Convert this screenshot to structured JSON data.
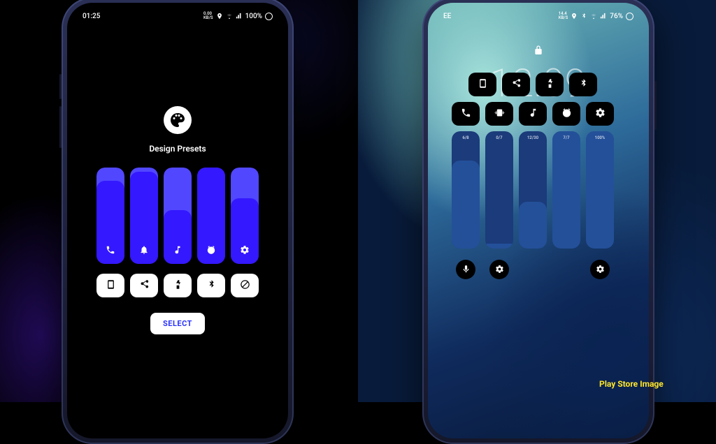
{
  "caption": "Play Store Image",
  "left_phone": {
    "status": {
      "time": "01:25",
      "battery": "100%"
    },
    "heading": "Design Presets",
    "sliders": [
      {
        "icon": "phone-icon",
        "fill_pct": 86
      },
      {
        "icon": "bell-icon",
        "fill_pct": 96
      },
      {
        "icon": "music-icon",
        "fill_pct": 56
      },
      {
        "icon": "alarm-icon",
        "fill_pct": 100
      },
      {
        "icon": "gear-icon",
        "fill_pct": 68
      }
    ],
    "buttons": [
      {
        "icon": "screen-icon"
      },
      {
        "icon": "share-icon"
      },
      {
        "icon": "flashlight-icon"
      },
      {
        "icon": "bluetooth-icon"
      },
      {
        "icon": "block-icon"
      }
    ],
    "select_label": "SELECT"
  },
  "right_phone": {
    "status": {
      "carrier": "EE",
      "battery": "76%"
    },
    "clock": "12:09",
    "row1": [
      {
        "icon": "screen-icon"
      },
      {
        "icon": "share-icon"
      },
      {
        "icon": "flashlight-icon"
      },
      {
        "icon": "bluetooth-icon"
      }
    ],
    "row2": [
      {
        "icon": "phone-icon"
      },
      {
        "icon": "vibrate-icon"
      },
      {
        "icon": "music-icon"
      },
      {
        "icon": "alarm-icon"
      },
      {
        "icon": "gear-icon"
      }
    ],
    "sliders": [
      {
        "label": "6/8",
        "fill_pct": 75
      },
      {
        "label": "0/7",
        "fill_pct": 4
      },
      {
        "label": "12/30",
        "fill_pct": 40
      },
      {
        "label": "7/7",
        "fill_pct": 100
      },
      {
        "label": "100%",
        "fill_pct": 100
      }
    ],
    "bottom_buttons": {
      "c0": "mic-icon",
      "c1": "gear-icon",
      "c4": "gear-icon"
    }
  },
  "colors": {
    "left_slider_track": "#5147ff",
    "left_slider_fill": "#3418ff",
    "right_slider_track": "#1b3b7a",
    "right_slider_fill": "#245099"
  }
}
